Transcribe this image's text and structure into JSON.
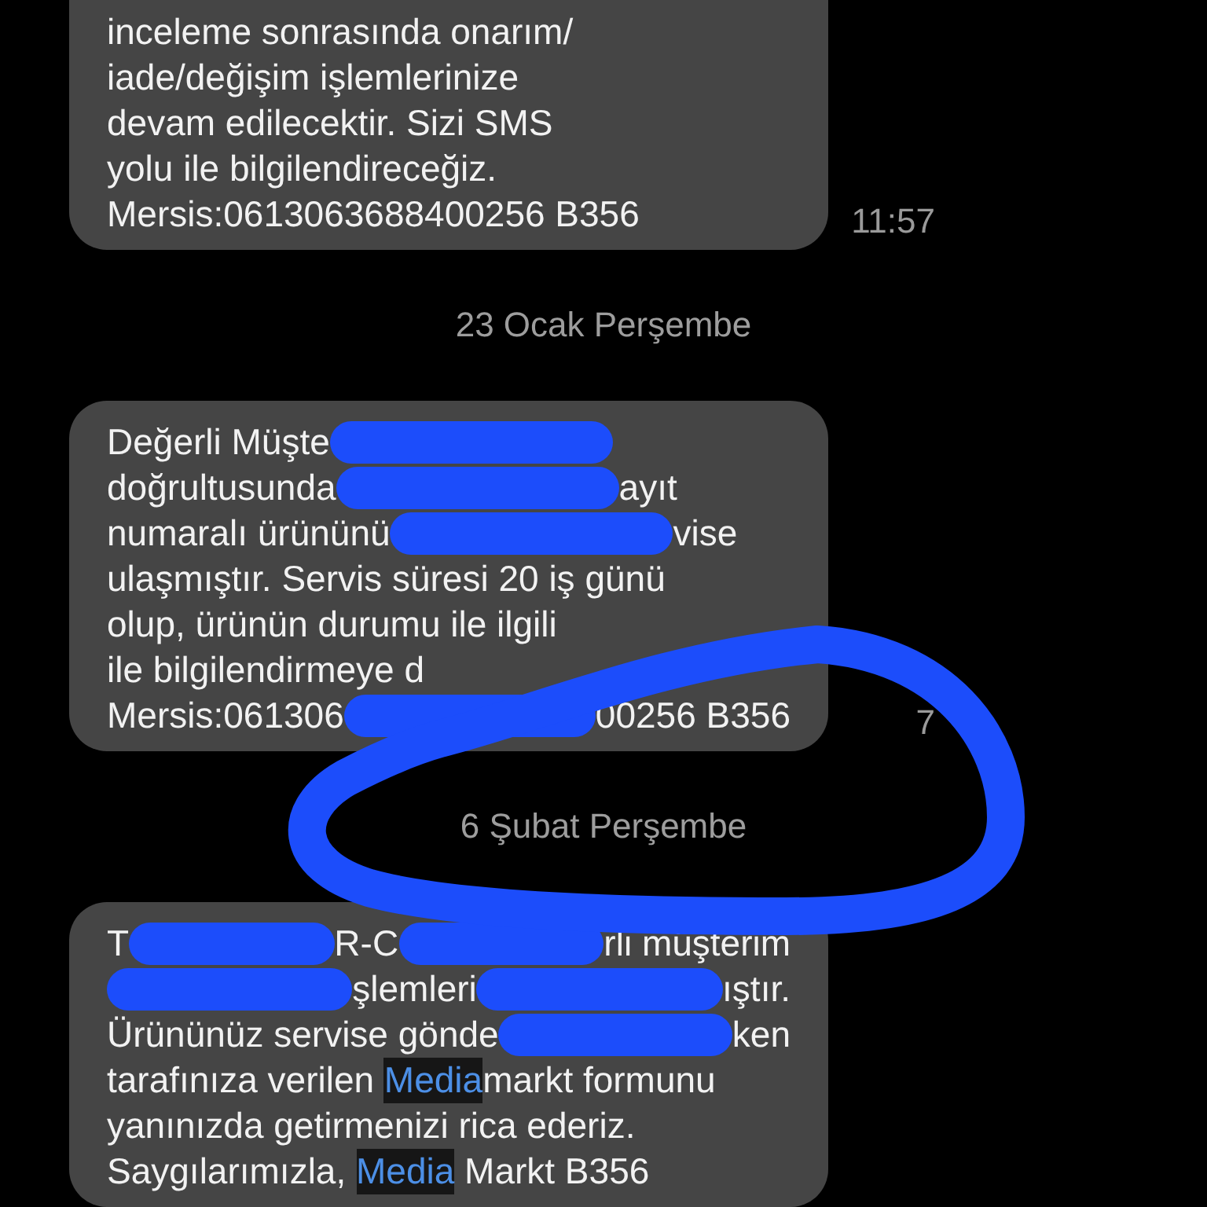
{
  "thread": [
    {
      "kind": "message",
      "time": "11:57",
      "lines": [
        [
          {
            "kind": "text",
            "text": "inceleme sonrasında onarım/"
          }
        ],
        [
          {
            "kind": "text",
            "text": "iade/değişim işlemlerinize"
          }
        ],
        [
          {
            "kind": "text",
            "text": "devam edilecektir. Sizi SMS"
          }
        ],
        [
          {
            "kind": "text",
            "text": "yolu ile bilgilendireceğiz."
          }
        ],
        [
          {
            "kind": "text",
            "text": "Mersis:0613063688400256 B356"
          }
        ]
      ]
    },
    {
      "kind": "date",
      "label": "23 Ocak Perşembe"
    },
    {
      "kind": "message",
      "time": "7",
      "lines": [
        [
          {
            "kind": "text",
            "text": "Değerli Müşte"
          },
          {
            "kind": "scribble"
          }
        ],
        [
          {
            "kind": "text",
            "text": "doğrultusunda"
          },
          {
            "kind": "scribble"
          },
          {
            "kind": "text",
            "text": "ayıt"
          }
        ],
        [
          {
            "kind": "text",
            "text": "numaralı ürününü"
          },
          {
            "kind": "scribble"
          },
          {
            "kind": "text",
            "text": "vise"
          }
        ],
        [
          {
            "kind": "text",
            "text": "ulaşmıştır. Servis süresi 20 iş günü"
          }
        ],
        [
          {
            "kind": "text",
            "text": "olup, ürünün durumu ile ilgili"
          }
        ],
        [
          {
            "kind": "text",
            "text": "ile bilgilendirmeye d"
          }
        ],
        [
          {
            "kind": "text",
            "text": "Mersis:061306"
          },
          {
            "kind": "scribble"
          },
          {
            "kind": "text",
            "text": "00256 B356"
          }
        ]
      ]
    },
    {
      "kind": "date",
      "label": "6 Şubat Perşembe"
    },
    {
      "kind": "message",
      "lines": [
        [
          {
            "kind": "text",
            "text": "T"
          },
          {
            "kind": "scribble"
          },
          {
            "kind": "text",
            "text": "R-C"
          },
          {
            "kind": "scribble"
          },
          {
            "kind": "text",
            "text": "rli müşterim"
          }
        ],
        [
          {
            "kind": "scribble"
          },
          {
            "kind": "text",
            "text": "şlemleri"
          },
          {
            "kind": "scribble"
          },
          {
            "kind": "text",
            "text": "ıştır."
          }
        ],
        [
          {
            "kind": "text",
            "text": "Ürününüz servise gönde"
          },
          {
            "kind": "scribble"
          },
          {
            "kind": "text",
            "text": "ken"
          }
        ],
        [
          {
            "kind": "text",
            "text": "tarafınıza verilen "
          },
          {
            "kind": "highlight",
            "text": "Media"
          },
          {
            "kind": "text",
            "text": "markt formunu"
          }
        ],
        [
          {
            "kind": "text",
            "text": "yanınızda getirmenizi rica ederiz."
          }
        ],
        [
          {
            "kind": "text",
            "text": "Saygılarımızla, "
          },
          {
            "kind": "highlight",
            "text": "Media"
          },
          {
            "kind": "text",
            "text": " Markt B356"
          }
        ]
      ]
    }
  ],
  "annotation": {
    "kind": "circle"
  }
}
